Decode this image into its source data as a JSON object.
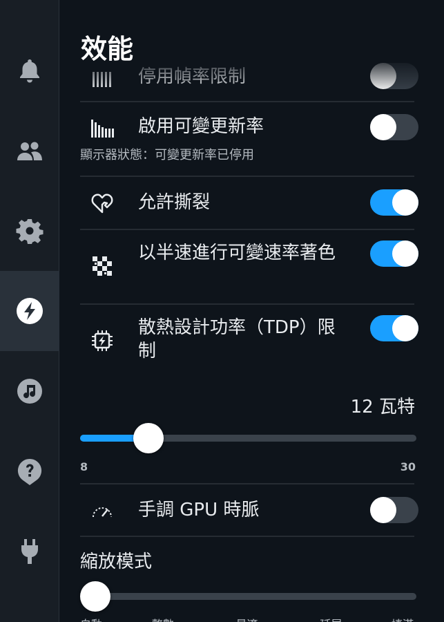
{
  "panel": {
    "title": "效能"
  },
  "sidebar": {
    "items": [
      {
        "icon": "bell-icon",
        "active": false
      },
      {
        "icon": "friends-icon",
        "active": false
      },
      {
        "icon": "gear-icon",
        "active": false
      },
      {
        "icon": "performance-bolt-icon",
        "active": true
      },
      {
        "icon": "music-icon",
        "active": false
      },
      {
        "icon": "help-icon",
        "active": false
      },
      {
        "icon": "power-plug-icon",
        "active": false
      }
    ]
  },
  "settings": {
    "framerate_limit": {
      "label": "停用幀率限制",
      "icon": "bars-icon",
      "on": false
    },
    "vrr": {
      "label": "啟用可變更新率",
      "icon": "refresh-bars-icon",
      "on": false,
      "status": "顯示器狀態：可變更新率已停用"
    },
    "tearing": {
      "label": "允許撕裂",
      "icon": "heart-outline-icon",
      "on": true
    },
    "half_rate_shading": {
      "label": "以半速進行可變速率著色",
      "icon": "checkerboard-icon",
      "on": true
    },
    "tdp_limit": {
      "label": "散熱設計功率（TDP）限制",
      "icon": "chip-bolt-icon",
      "on": true
    }
  },
  "tdp_slider": {
    "value_text": "12 瓦特",
    "min": 8,
    "max": 30,
    "value": 12,
    "min_label": "8",
    "max_label": "30"
  },
  "gpu_clock": {
    "label": "手調 GPU 時脈",
    "icon": "gauge-icon",
    "on": false
  },
  "scaling": {
    "label": "縮放模式",
    "value_index": 0,
    "options": [
      "自動",
      "整數",
      "最適",
      "延展",
      "填滿"
    ]
  },
  "colors": {
    "accent": "#1a9fff",
    "background": "#0e141b",
    "sidebar": "#181e25"
  }
}
